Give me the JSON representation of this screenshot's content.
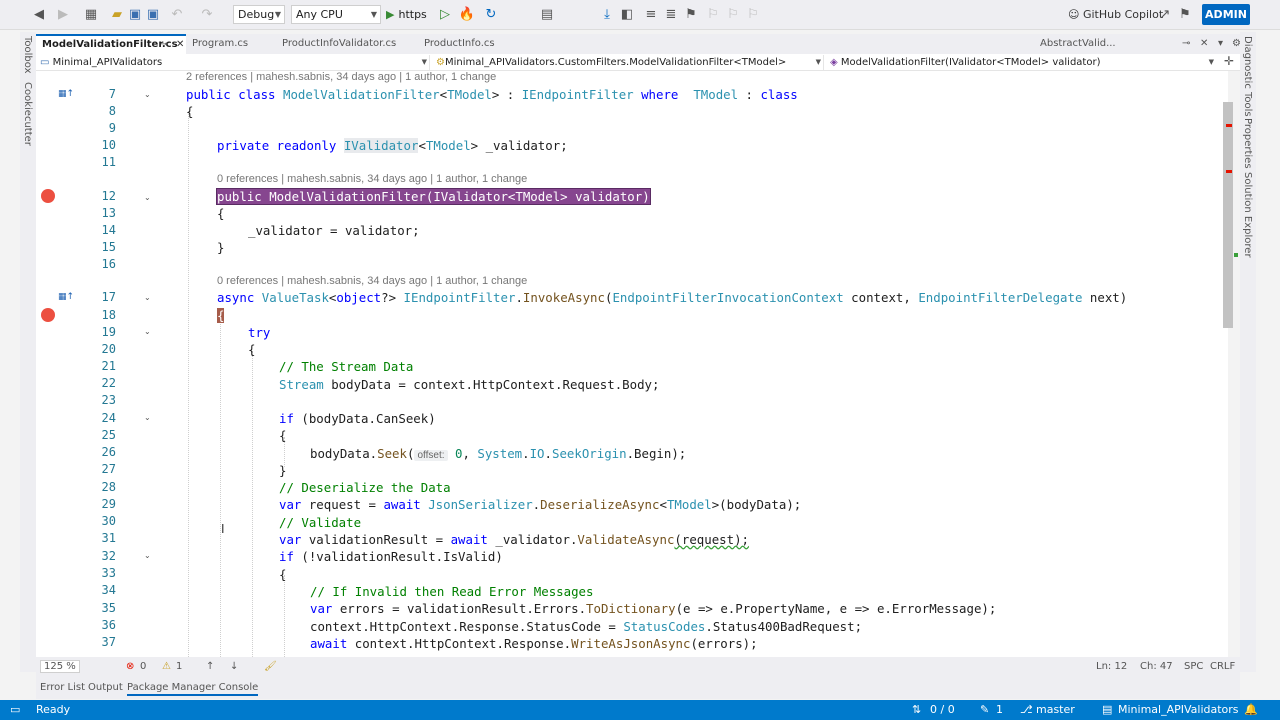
{
  "toolbar": {
    "config": "Debug",
    "platform": "Any CPU",
    "run_label": "https",
    "copilot_label": "GitHub Copilot",
    "admin_label": "ADMIN",
    "icons": [
      "nav-back-icon",
      "nav-forward-icon",
      "new-project-icon",
      "open-file-icon",
      "save-icon",
      "save-all-icon",
      "undo-icon",
      "redo-icon",
      "run-icon",
      "start-without-debug-icon",
      "hot-reload-icon",
      "refresh-icon",
      "breakpoint-icon",
      "bookmark-icon"
    ]
  },
  "left_rail": {
    "toolbox": "Toolbox",
    "cookiecutter": "Cookiecutter"
  },
  "right_rail": {
    "diagnostic": "Diagnostic Tools",
    "properties": "Properties",
    "solution": "Solution Explorer"
  },
  "tabs": [
    {
      "label": "ModelValidationFilter.cs",
      "active": true
    },
    {
      "label": "Program.cs"
    },
    {
      "label": "ProductInfoValidator.cs"
    },
    {
      "label": "ProductInfo.cs"
    },
    {
      "label": "AbstractValid... [SourceLink]"
    }
  ],
  "navbar": {
    "project": "Minimal_APIValidators",
    "type": "Minimal_APIValidators.CustomFilters.ModelValidationFilter<TModel>",
    "member": "ModelValidationFilter(IValidator<TModel> validator)"
  },
  "code_lens": {
    "class": "2 references | mahesh.sabnis, 34 days ago | 1 author, 1 change",
    "ctor": "0 references | mahesh.sabnis, 34 days ago | 1 author, 1 change",
    "invoke": "0 references | mahesh.sabnis, 34 days ago | 1 author, 1 change"
  },
  "line_numbers": [
    "7",
    "8",
    "9",
    "10",
    "11",
    "12",
    "13",
    "14",
    "15",
    "16",
    "17",
    "18",
    "19",
    "20",
    "21",
    "22",
    "23",
    "24",
    "25",
    "26",
    "27",
    "28",
    "29",
    "30",
    "31",
    "32",
    "33",
    "34",
    "35",
    "36",
    "37"
  ],
  "code": {
    "l7_kw1": "public class ",
    "l7_ty1": "ModelValidationFilter",
    "l7_t1": "<",
    "l7_ty2": "TModel",
    "l7_t2": "> : ",
    "l7_ty3": "IEndpointFilter",
    "l7_kw2": " where ",
    "l7_ty4": "TModel",
    "l7_t3": " : ",
    "l7_kw3": "class",
    "l8": "{",
    "l10_kw": "private readonly ",
    "l10_ty1": "IValidator",
    "l10_t1": "<",
    "l10_ty2": "TModel",
    "l10_t2": "> _validator;",
    "l12": "public ModelValidationFilter(IValidator<TModel> validator)",
    "l13": "{",
    "l14": "_validator = validator;",
    "l15": "}",
    "l17_kw": "async ",
    "l17_ty1": "ValueTask",
    "l17_t1": "<",
    "l17_kw2": "object",
    "l17_t2": "?> ",
    "l17_ty2": "IEndpointFilter",
    "l17_t3": ".",
    "l17_mt": "InvokeAsync",
    "l17_t4": "(",
    "l17_ty3": "EndpointFilterInvocationContext",
    "l17_t5": " context, ",
    "l17_ty4": "EndpointFilterDelegate",
    "l17_t6": " next)",
    "l18": "{",
    "l19": "try",
    "l20": "{",
    "l21": "// The Stream Data",
    "l22_ty": "Stream",
    "l22_t": " bodyData = context.HttpContext.Request.Body;",
    "l24_kw": "if",
    "l24_t": " (bodyData.CanSeek)",
    "l25": "{",
    "l26_t1": "bodyData.",
    "l26_mt": "Seek",
    "l26_t2": "(",
    "l26_hint": "offset:",
    "l26_num": " 0",
    "l26_t3": ", ",
    "l26_ty1": "System",
    "l26_t4": ".",
    "l26_ty2": "IO",
    "l26_t5": ".",
    "l26_ty3": "SeekOrigin",
    "l26_t6": ".Begin);",
    "l27": "}",
    "l28": "// Deserialize the Data",
    "l29_kw1": "var",
    "l29_t1": " request = ",
    "l29_kw2": "await ",
    "l29_ty1": "JsonSerializer",
    "l29_t2": ".",
    "l29_mt": "DeserializeAsync",
    "l29_t3": "<",
    "l29_ty2": "TModel",
    "l29_t4": ">(bodyData);",
    "l30": "// Validate",
    "l31_kw1": "var",
    "l31_t1": " validationResult = ",
    "l31_kw2": "await ",
    "l31_t2": "_validator.",
    "l31_mt": "ValidateAsync",
    "l31_t3": "(request);",
    "l32_kw": "if",
    "l32_t": " (!validationResult.IsValid)",
    "l33": "{",
    "l34": "// If Invalid then Read Error Messages",
    "l35_kw": "var",
    "l35_t1": " errors = validationResult.Errors.",
    "l35_mt": "ToDictionary",
    "l35_t2": "(e => e.PropertyName, e => e.ErrorMessage);",
    "l36_t1": "context.HttpContext.Response.StatusCode = ",
    "l36_ty": "StatusCodes",
    "l36_t2": ".Status400BadRequest;",
    "l37_kw": "await ",
    "l37_t1": "context.HttpContext.Response.",
    "l37_mt": "WriteAsJsonAsync",
    "l37_t2": "(errors);"
  },
  "editor_status": {
    "zoom": "125 %",
    "errors": "0",
    "warnings": "1",
    "line": "Ln: 12",
    "col": "Ch: 47",
    "spc": "SPC",
    "crlf": "CRLF"
  },
  "tool_tabs": [
    "Error List",
    "Output",
    "Package Manager Console"
  ],
  "statusbar": {
    "ready": "Ready",
    "changes": "0 / 0",
    "edits": "1",
    "branch": "master",
    "repo": "Minimal_APIValidators"
  },
  "colors": {
    "accent": "#0067c0",
    "statusbar": "#007acc",
    "breakpoint": "#e51400",
    "selection": "#86468f"
  }
}
